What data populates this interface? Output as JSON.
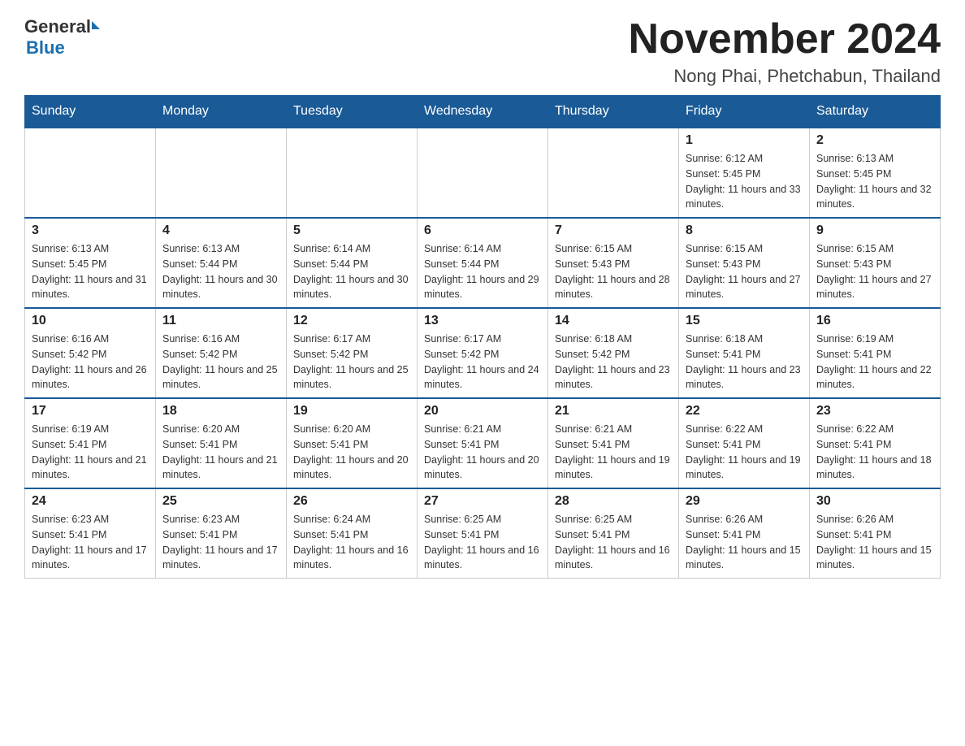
{
  "header": {
    "logo_general": "General",
    "logo_blue": "Blue",
    "title": "November 2024",
    "subtitle": "Nong Phai, Phetchabun, Thailand"
  },
  "days_of_week": [
    "Sunday",
    "Monday",
    "Tuesday",
    "Wednesday",
    "Thursday",
    "Friday",
    "Saturday"
  ],
  "weeks": [
    {
      "days": [
        {
          "date": "",
          "info": ""
        },
        {
          "date": "",
          "info": ""
        },
        {
          "date": "",
          "info": ""
        },
        {
          "date": "",
          "info": ""
        },
        {
          "date": "",
          "info": ""
        },
        {
          "date": "1",
          "info": "Sunrise: 6:12 AM\nSunset: 5:45 PM\nDaylight: 11 hours and 33 minutes."
        },
        {
          "date": "2",
          "info": "Sunrise: 6:13 AM\nSunset: 5:45 PM\nDaylight: 11 hours and 32 minutes."
        }
      ]
    },
    {
      "days": [
        {
          "date": "3",
          "info": "Sunrise: 6:13 AM\nSunset: 5:45 PM\nDaylight: 11 hours and 31 minutes."
        },
        {
          "date": "4",
          "info": "Sunrise: 6:13 AM\nSunset: 5:44 PM\nDaylight: 11 hours and 30 minutes."
        },
        {
          "date": "5",
          "info": "Sunrise: 6:14 AM\nSunset: 5:44 PM\nDaylight: 11 hours and 30 minutes."
        },
        {
          "date": "6",
          "info": "Sunrise: 6:14 AM\nSunset: 5:44 PM\nDaylight: 11 hours and 29 minutes."
        },
        {
          "date": "7",
          "info": "Sunrise: 6:15 AM\nSunset: 5:43 PM\nDaylight: 11 hours and 28 minutes."
        },
        {
          "date": "8",
          "info": "Sunrise: 6:15 AM\nSunset: 5:43 PM\nDaylight: 11 hours and 27 minutes."
        },
        {
          "date": "9",
          "info": "Sunrise: 6:15 AM\nSunset: 5:43 PM\nDaylight: 11 hours and 27 minutes."
        }
      ]
    },
    {
      "days": [
        {
          "date": "10",
          "info": "Sunrise: 6:16 AM\nSunset: 5:42 PM\nDaylight: 11 hours and 26 minutes."
        },
        {
          "date": "11",
          "info": "Sunrise: 6:16 AM\nSunset: 5:42 PM\nDaylight: 11 hours and 25 minutes."
        },
        {
          "date": "12",
          "info": "Sunrise: 6:17 AM\nSunset: 5:42 PM\nDaylight: 11 hours and 25 minutes."
        },
        {
          "date": "13",
          "info": "Sunrise: 6:17 AM\nSunset: 5:42 PM\nDaylight: 11 hours and 24 minutes."
        },
        {
          "date": "14",
          "info": "Sunrise: 6:18 AM\nSunset: 5:42 PM\nDaylight: 11 hours and 23 minutes."
        },
        {
          "date": "15",
          "info": "Sunrise: 6:18 AM\nSunset: 5:41 PM\nDaylight: 11 hours and 23 minutes."
        },
        {
          "date": "16",
          "info": "Sunrise: 6:19 AM\nSunset: 5:41 PM\nDaylight: 11 hours and 22 minutes."
        }
      ]
    },
    {
      "days": [
        {
          "date": "17",
          "info": "Sunrise: 6:19 AM\nSunset: 5:41 PM\nDaylight: 11 hours and 21 minutes."
        },
        {
          "date": "18",
          "info": "Sunrise: 6:20 AM\nSunset: 5:41 PM\nDaylight: 11 hours and 21 minutes."
        },
        {
          "date": "19",
          "info": "Sunrise: 6:20 AM\nSunset: 5:41 PM\nDaylight: 11 hours and 20 minutes."
        },
        {
          "date": "20",
          "info": "Sunrise: 6:21 AM\nSunset: 5:41 PM\nDaylight: 11 hours and 20 minutes."
        },
        {
          "date": "21",
          "info": "Sunrise: 6:21 AM\nSunset: 5:41 PM\nDaylight: 11 hours and 19 minutes."
        },
        {
          "date": "22",
          "info": "Sunrise: 6:22 AM\nSunset: 5:41 PM\nDaylight: 11 hours and 19 minutes."
        },
        {
          "date": "23",
          "info": "Sunrise: 6:22 AM\nSunset: 5:41 PM\nDaylight: 11 hours and 18 minutes."
        }
      ]
    },
    {
      "days": [
        {
          "date": "24",
          "info": "Sunrise: 6:23 AM\nSunset: 5:41 PM\nDaylight: 11 hours and 17 minutes."
        },
        {
          "date": "25",
          "info": "Sunrise: 6:23 AM\nSunset: 5:41 PM\nDaylight: 11 hours and 17 minutes."
        },
        {
          "date": "26",
          "info": "Sunrise: 6:24 AM\nSunset: 5:41 PM\nDaylight: 11 hours and 16 minutes."
        },
        {
          "date": "27",
          "info": "Sunrise: 6:25 AM\nSunset: 5:41 PM\nDaylight: 11 hours and 16 minutes."
        },
        {
          "date": "28",
          "info": "Sunrise: 6:25 AM\nSunset: 5:41 PM\nDaylight: 11 hours and 16 minutes."
        },
        {
          "date": "29",
          "info": "Sunrise: 6:26 AM\nSunset: 5:41 PM\nDaylight: 11 hours and 15 minutes."
        },
        {
          "date": "30",
          "info": "Sunrise: 6:26 AM\nSunset: 5:41 PM\nDaylight: 11 hours and 15 minutes."
        }
      ]
    }
  ]
}
